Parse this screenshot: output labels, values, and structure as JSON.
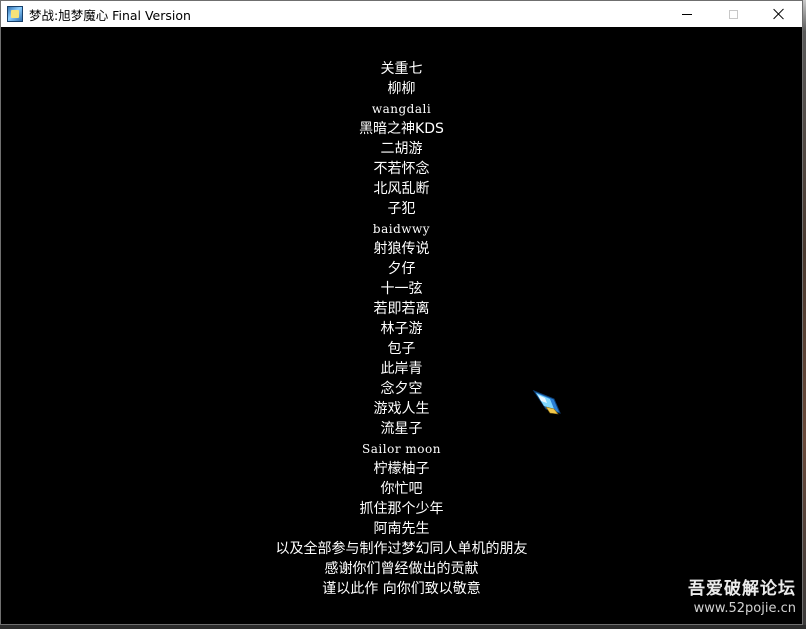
{
  "window": {
    "title": "梦战:旭梦魔心 Final Version",
    "icon": "game-app-icon",
    "controls": {
      "minimize": "minimize-icon",
      "maximize": "maximize-icon",
      "close": "close-icon"
    }
  },
  "credits": [
    "关重七",
    "柳柳",
    "wangdali",
    "黑暗之神KDS",
    "二胡游",
    "不若怀念",
    "北风乱断",
    "子犯",
    "baidwwy",
    "射狼传说",
    "夕仔",
    "十一弦",
    "若即若离",
    "林子游",
    "包子",
    "此岸青",
    "念夕空",
    "游戏人生",
    "流星子",
    "Sailor moon",
    "柠檬柚子",
    "你忙吧",
    "抓住那个少年",
    "阿南先生",
    "以及全部参与制作过梦幻同人单机的朋友",
    "感谢你们曾经做出的贡献",
    "谨以此作 向你们致以敬意"
  ],
  "cursor": {
    "icon": "game-cursor-icon"
  },
  "watermark": {
    "title": "吾爱破解论坛",
    "url": "www.52pojie.cn"
  },
  "colors": {
    "canvas_background": "#000000",
    "credit_text": "#ffffff",
    "titlebar_background": "#ffffff"
  }
}
